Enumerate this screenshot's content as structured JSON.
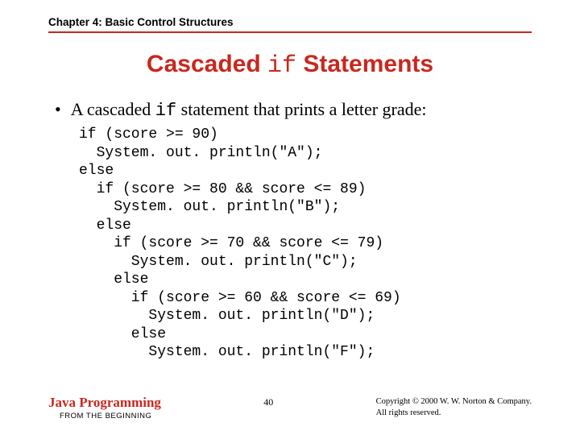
{
  "header": "Chapter 4: Basic Control Structures",
  "title": {
    "pre": "Cascaded ",
    "mid": "if",
    "post": " Statements"
  },
  "bullet": {
    "dot": "•",
    "pre": "A cascaded ",
    "mid": "if",
    "post": " statement that prints a letter grade:"
  },
  "code": "if (score >= 90)\n  System. out. println(\"A\");\nelse\n  if (score >= 80 && score <= 89)\n    System. out. println(\"B\");\n  else\n    if (score >= 70 && score <= 79)\n      System. out. println(\"C\");\n    else\n      if (score >= 60 && score <= 69)\n        System. out. println(\"D\");\n      else\n        System. out. println(\"F\");",
  "footer": {
    "brand": "Java Programming",
    "brand_sub": "FROM THE BEGINNING",
    "page": "40",
    "copyright1": "Copyright © 2000 W. W. Norton & Company.",
    "copyright2": "All rights reserved."
  }
}
